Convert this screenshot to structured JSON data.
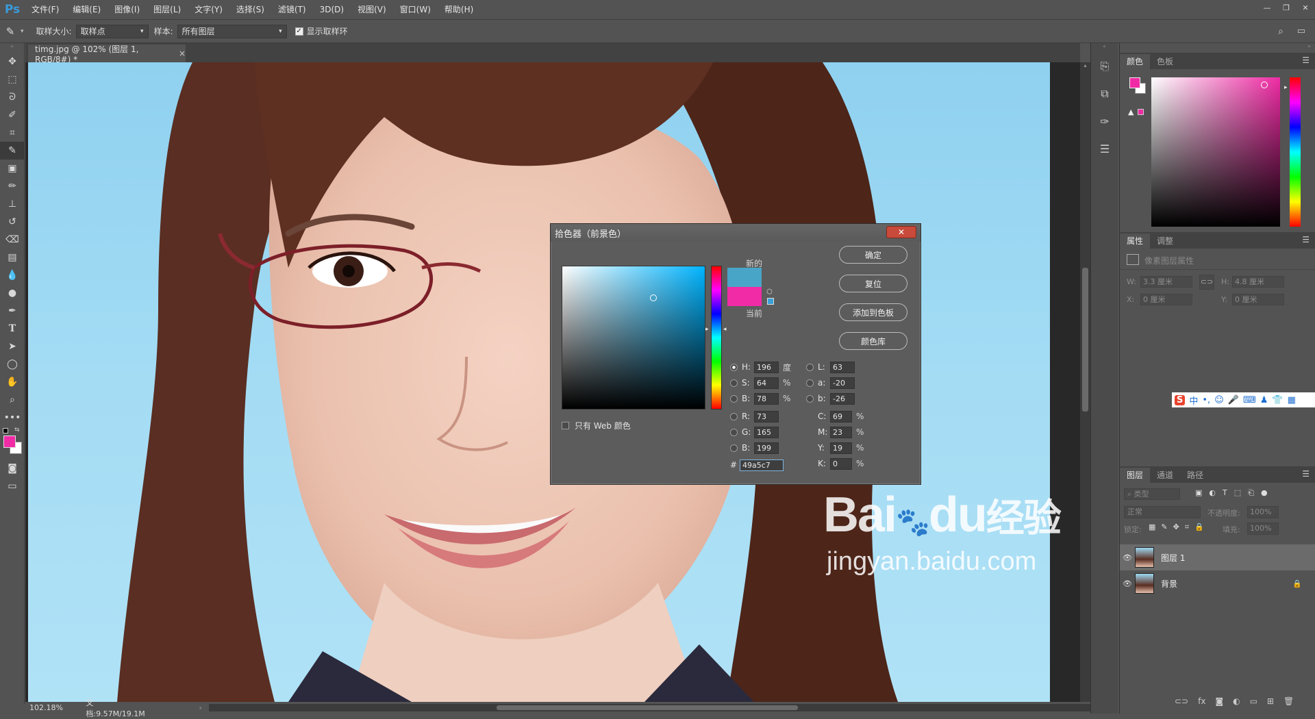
{
  "app": {
    "logo": "Ps"
  },
  "menu": [
    "文件(F)",
    "编辑(E)",
    "图像(I)",
    "图层(L)",
    "文字(Y)",
    "选择(S)",
    "滤镜(T)",
    "3D(D)",
    "视图(V)",
    "窗口(W)",
    "帮助(H)"
  ],
  "options": {
    "sample_size_label": "取样大小:",
    "sample_size_value": "取样点",
    "sample_label": "样本:",
    "sample_value": "所有图层",
    "show_ring_label": "显示取样环"
  },
  "document": {
    "tab_title": "timg.jpg @ 102% (图层 1, RGB/8#) *"
  },
  "status": {
    "zoom": "102.18%",
    "doc_info": "文档:9.57M/19.1M"
  },
  "color_panel": {
    "tabs": [
      "颜色",
      "色板"
    ],
    "foreground_color": "#f02ba5"
  },
  "properties_panel": {
    "tabs": [
      "属性",
      "调整"
    ],
    "title": "像素图层属性",
    "w_label": "W:",
    "w_value": "3.3 厘米",
    "h_label": "H:",
    "h_value": "4.8 厘米",
    "x_label": "X:",
    "x_value": "0 厘米",
    "y_label": "Y:",
    "y_value": "0 厘米"
  },
  "layers_panel": {
    "tabs": [
      "图层",
      "通道",
      "路径"
    ],
    "filter_placeholder": "类型",
    "blend_mode": "正常",
    "opacity_label": "不透明度:",
    "opacity_value": "100%",
    "lock_label": "锁定:",
    "fill_label": "填充:",
    "fill_value": "100%",
    "layers": [
      {
        "name": "图层 1",
        "selected": true
      },
      {
        "name": "背景",
        "selected": false,
        "locked": true
      }
    ]
  },
  "dialog": {
    "title": "拾色器（前景色）",
    "close": "✕",
    "new_label": "新的",
    "current_label": "当前",
    "new_color": "#49a5c7",
    "current_color": "#f02ba5",
    "buttons": {
      "ok": "确定",
      "reset": "复位",
      "add_swatch": "添加到色板",
      "library": "颜色库"
    },
    "web_only_label": "只有 Web 颜色",
    "hsb": {
      "H": "196",
      "H_unit": "度",
      "S": "64",
      "S_unit": "%",
      "B": "78",
      "B_unit": "%"
    },
    "rgb": {
      "R": "73",
      "G": "165",
      "B": "199"
    },
    "lab": {
      "L": "63",
      "a": "-20",
      "b": "-26"
    },
    "cmyk": {
      "C": "69",
      "M": "23",
      "Y": "19",
      "K": "0",
      "unit": "%"
    },
    "hex_label": "#",
    "hex": "49a5c7"
  },
  "ime_toolbar": {
    "lang": "中"
  },
  "watermark": {
    "brand": "Bai",
    "brand2": "du",
    "brand3": "经验",
    "url": "jingyan.baidu.com"
  }
}
